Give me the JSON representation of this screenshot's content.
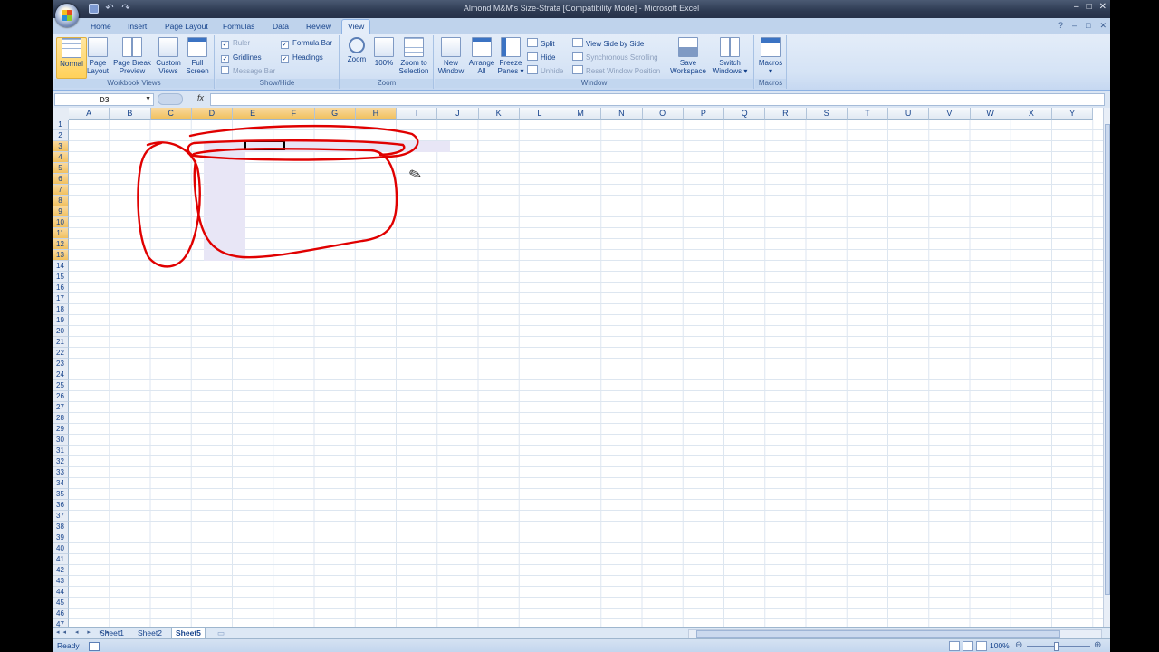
{
  "window": {
    "title": "Almond M&M's Size-Strata  [Compatibility Mode] - Microsoft Excel",
    "controls": [
      "–",
      "□",
      "✕"
    ],
    "help_controls": [
      "?",
      "–",
      "□",
      "✕"
    ]
  },
  "ribbon_tabs": [
    "Home",
    "Insert",
    "Page Layout",
    "Formulas",
    "Data",
    "Review",
    "View"
  ],
  "active_tab": "View",
  "ribbon": {
    "workbook_views": {
      "label": "Workbook Views",
      "normal": "Normal",
      "page_layout": [
        "Page",
        "Layout"
      ],
      "page_break": [
        "Page Break",
        "Preview"
      ],
      "custom_views": [
        "Custom",
        "Views"
      ],
      "full_screen": [
        "Full",
        "Screen"
      ]
    },
    "show_hide": {
      "label": "Show/Hide",
      "ruler": "Ruler",
      "gridlines": "Gridlines",
      "message_bar": "Message Bar",
      "formula_bar": "Formula Bar",
      "headings": "Headings",
      "check": "✓"
    },
    "zoom": {
      "label": "Zoom",
      "zoom": "Zoom",
      "hundred": "100%",
      "zoom_selection": [
        "Zoom to",
        "Selection"
      ]
    },
    "window": {
      "label": "Window",
      "new_window": [
        "New",
        "Window"
      ],
      "arrange_all": [
        "Arrange",
        "All"
      ],
      "freeze_panes": [
        "Freeze",
        "Panes ▾"
      ],
      "split": "Split",
      "hide": "Hide",
      "unhide": "Unhide",
      "side_by_side": "View Side by Side",
      "sync_scroll": "Synchronous Scrolling",
      "reset_position": "Reset Window Position",
      "save_workspace": [
        "Save",
        "Workspace"
      ],
      "switch_windows": [
        "Switch",
        "Windows ▾"
      ]
    },
    "macros": {
      "label": "Macros",
      "macros": "Macros",
      "arrow": "▾"
    }
  },
  "formula_bar": {
    "name_box": "D3",
    "fx": "fx",
    "value": ""
  },
  "columns": [
    "A",
    "B",
    "C",
    "D",
    "E",
    "F",
    "G",
    "H",
    "I",
    "J",
    "K",
    "L",
    "M",
    "N",
    "O",
    "P",
    "Q",
    "R",
    "S",
    "T",
    "U",
    "V",
    "W",
    "X",
    "Y"
  ],
  "selected_columns": [
    "C",
    "D",
    "E",
    "F",
    "G",
    "H"
  ],
  "rows": [
    "1",
    "2",
    "3",
    "4",
    "5",
    "6",
    "7",
    "8",
    "9",
    "10",
    "11",
    "12",
    "13",
    "14",
    "15",
    "16",
    "17",
    "18",
    "19",
    "20",
    "21",
    "22",
    "23",
    "24",
    "25",
    "26",
    "27",
    "28",
    "29",
    "30",
    "31",
    "32",
    "33",
    "34",
    "35",
    "36",
    "37",
    "38",
    "39",
    "40",
    "41",
    "42",
    "43",
    "44",
    "45",
    "46",
    "47"
  ],
  "selected_rows": [
    "3",
    "4",
    "5",
    "6",
    "7",
    "8",
    "9",
    "10",
    "11",
    "12",
    "13"
  ],
  "active_cell": "D3",
  "sheet_tabs": {
    "nav": "◂◂ ◂ ▸ ▸▸",
    "tabs": [
      "Sheet1",
      "Sheet2",
      "Sheet5"
    ],
    "active": "Sheet5"
  },
  "status": {
    "ready": "Ready",
    "zoom": "100%",
    "minus": "⊖",
    "plus": "⊕"
  },
  "colors": {
    "annotation_ink": "#e00000",
    "selection_fill": "#e8e6f6"
  }
}
